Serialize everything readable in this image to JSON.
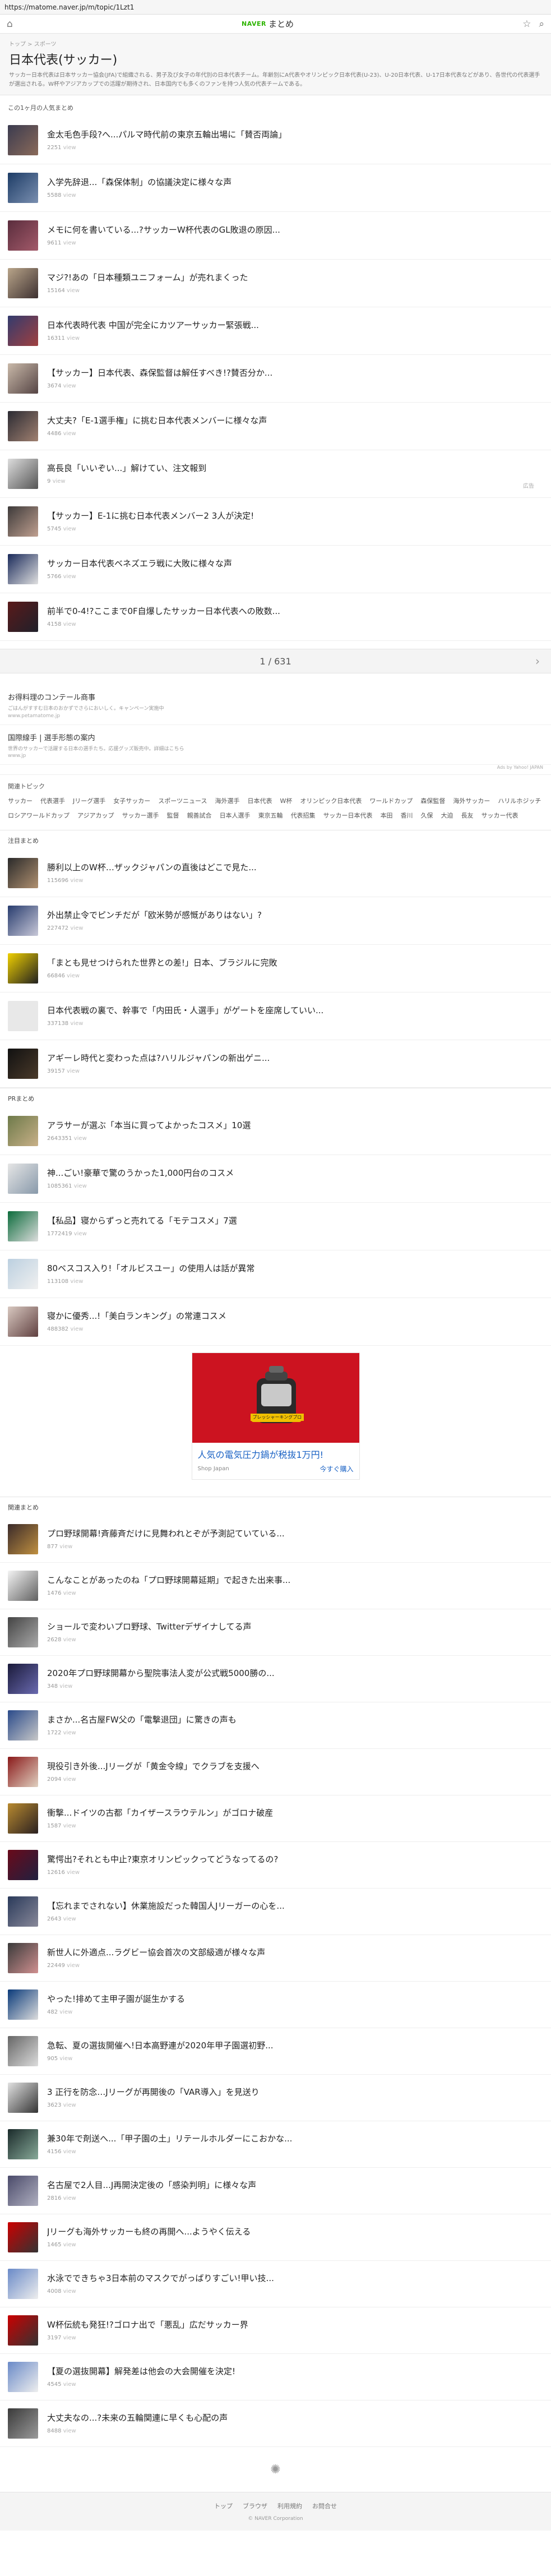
{
  "browser": {
    "url": "https://matome.naver.jp/m/topic/1Lzt1"
  },
  "header": {
    "brand": "NAVER",
    "product": "まとめ"
  },
  "topic": {
    "breadcrumb": "トップ > スポーツ",
    "title": "日本代表(サッカー)",
    "description": "サッカー日本代表は日本サッカー協会(JFA)で組織される、男子及び女子の年代別の日本代表チーム。年齢別にA代表やオリンピック日本代表(U-23)、U-20日本代表、U-17日本代表などがあり、各世代の代表選手が選出される。W杯やアジアカップでの活躍が期待され、日本国内でも多くのファンを持つ人気の代表チームである。"
  },
  "section_popular": "この1ヶ月の人気まとめ",
  "topic_items": [
    {
      "title": "金太毛色手段?へ...パルマ時代前の東京五輪出場に「賛否両論」",
      "views": "2251",
      "unit": "view"
    },
    {
      "title": "入学先辞退...「森保体制」の協議決定に様々な声",
      "views": "5588",
      "unit": "view"
    },
    {
      "title": "メモに何を書いている...?サッカーW杯代表のGL敗退の原因...",
      "views": "9611",
      "unit": "view"
    },
    {
      "title": "マジ?!あの「日本種類ユニフォーム」が売れまくった",
      "views": "15164",
      "unit": "view"
    },
    {
      "title": "日本代表時代表 中国が完全にカツアーサッカー緊張戦...",
      "views": "16311",
      "unit": "view"
    },
    {
      "title": "【サッカー】日本代表、森保監督は解任すべき!?賛否分か...",
      "views": "3674",
      "unit": "view"
    },
    {
      "title": "大丈夫?「E-1選手権」に挑む日本代表メンバーに様々な声",
      "views": "4486",
      "unit": "view"
    },
    {
      "title": "高長良「いいぞい...」解けてい、注文報到",
      "views": "9",
      "unit": "view",
      "note": "広告"
    },
    {
      "title": "【サッカー】E-1に挑む日本代表メンバー2 3人が決定!",
      "views": "5745",
      "unit": "view"
    },
    {
      "title": "サッカー日本代表ベネズエラ戦に大敗に様々な声",
      "views": "5766",
      "unit": "view"
    },
    {
      "title": "前半で0-4!?ここまで0F自爆したサッカー日本代表への敗数...",
      "views": "4158",
      "unit": "view"
    }
  ],
  "pager": {
    "label": "1 / 631"
  },
  "text_ads": [
    {
      "title": "お得料理のコンテール商事",
      "desc": "ごはんがすすむ日本のおかずでさらにおいしく。キャンペーン実施中",
      "url": "www.petamatome.jp"
    },
    {
      "title": "国際線手 | 選手形態の案内",
      "desc": "世界のサッカーで活躍する日本の選手たち。応援グッズ販売中。詳細はこちら",
      "url": "www.jp"
    }
  ],
  "ad_attribution": "Ads by Yahoo! JAPAN",
  "keywords": {
    "title": "関連トピック",
    "items": [
      "サッカー",
      "代表選手",
      "Jリーグ選手",
      "女子サッカー",
      "スポーツニュース",
      "海外選手",
      "日本代表",
      "W杯",
      "オリンピック日本代表",
      "ワールドカップ",
      "森保監督",
      "海外サッカー",
      "ハリルホジッチ",
      "ロシアワールドカップ",
      "アジアカップ",
      "サッカー選手",
      "監督",
      "親善試合",
      "日本人選手",
      "東京五輪",
      "代表招集",
      "サッカー日本代表",
      "本田",
      "香川",
      "久保",
      "大迫",
      "長友",
      "サッカー代表"
    ]
  },
  "section_special": "注目まとめ",
  "special_items": [
    {
      "title": "勝利以上のW杯…ザックジャパンの直後はどこで見た...",
      "views": "115696",
      "unit": "view"
    },
    {
      "title": "外出禁止令でピンチだが「欧米勢が感慨がありはない」?",
      "views": "227472",
      "unit": "view"
    },
    {
      "title": "「まとも見せつけられた世界との差!」日本、ブラジルに完敗",
      "views": "66846",
      "unit": "view"
    },
    {
      "title": "日本代表戦の裏で、幹事で「内田氏・人選手」がゲートを座席していい...",
      "views": "337138",
      "unit": "view"
    },
    {
      "title": "アギーレ時代と変わった点は?ハリルジャパンの新出ゲニ...",
      "views": "39157",
      "unit": "view"
    }
  ],
  "section_pr": "PRまとめ",
  "pr_items": [
    {
      "title": "アラサーが選ぶ「本当に買ってよかったコスメ」10選",
      "views": "2643351",
      "unit": "view"
    },
    {
      "title": "神...ごい!豪華で驚のうかった1,000円台のコスメ",
      "views": "1085361",
      "unit": "view"
    },
    {
      "title": "【私品】寝からずっと売れてる「モテコスメ」7選",
      "views": "1772419",
      "unit": "view"
    },
    {
      "title": "80ベスコス入り!「オルビスユー」の使用人は話が異常",
      "views": "113108",
      "unit": "view"
    },
    {
      "title": "寝かに優秀...!「美白ランキング」の常連コスメ",
      "views": "488382",
      "unit": "view"
    }
  ],
  "banner_ad": {
    "badge": "プレッシャーキングプロ",
    "headline": "人気の電気圧力鍋が税抜1万円!",
    "shop": "Shop Japan",
    "cta": "今すぐ購入"
  },
  "section_related": "関連まとめ",
  "related_items": [
    {
      "title": "プロ野球開幕!斉藤斉だけに見舞われとぞが予測記ていている...",
      "views": "877",
      "unit": "view"
    },
    {
      "title": "こんなことがあったのね「プロ野球開幕延期」で起きた出来事...",
      "views": "1476",
      "unit": "view"
    },
    {
      "title": "ショールで変わいプロ野球、Twitterデザイナしてる声",
      "views": "2628",
      "unit": "view"
    },
    {
      "title": "2020年プロ野球開幕から聖院事法人変が公式戦5000勝の...",
      "views": "348",
      "unit": "view"
    },
    {
      "title": "まさか...名古屋FW父の「電撃退団」に驚きの声も",
      "views": "1722",
      "unit": "view"
    },
    {
      "title": "現役引き外後...Jリーグが「黄金令線」でクラブを支援へ",
      "views": "2094",
      "unit": "view"
    },
    {
      "title": "衝撃...ドイツの古都「カイザースラウテルン」がゴロナ破産",
      "views": "1587",
      "unit": "view"
    },
    {
      "title": "驚愕出?それとも中止?東京オリンピックってどうなってるの?",
      "views": "12616",
      "unit": "view"
    },
    {
      "title": "【忘れまでされない】休業施設だった韓国人Jリーガーの心を...",
      "views": "2643",
      "unit": "view"
    },
    {
      "title": "新世人に外適点...ラグビー協会首次の文部級適が様々な声",
      "views": "22449",
      "unit": "view"
    },
    {
      "title": "やった!排めて主甲子園が誕生かする",
      "views": "482",
      "unit": "view"
    },
    {
      "title": "急転、夏の選抜開催へ!日本高野連が2020年甲子園選初野...",
      "views": "905",
      "unit": "view"
    },
    {
      "title": "3 正行を防念…Jリーグが再開後の「VAR導入」を見送り",
      "views": "3623",
      "unit": "view"
    },
    {
      "title": "兼30年で剤送へ...「甲子園の土」リテールホルダーにこおかな...",
      "views": "4156",
      "unit": "view"
    },
    {
      "title": "名古屋で2人目...J再開決定後の「感染判明」に様々な声",
      "views": "2816",
      "unit": "view"
    },
    {
      "title": "Jリーグも海外サッカーも終の再開へ...ようやく伝える",
      "views": "1465",
      "unit": "view"
    },
    {
      "title": "水泳でできちゃ3日本前のマスクでがっばりすごい!甲い技...",
      "views": "4008",
      "unit": "view"
    },
    {
      "title": "W杯伝統も発狂!?ゴロナ出で「悪乱」広だサッカー界",
      "views": "3197",
      "unit": "view"
    },
    {
      "title": "【夏の選抜開幕】解発差は他会の大会開催を決定!",
      "views": "4545",
      "unit": "view"
    },
    {
      "title": "大丈夫なの...?未来の五輪関連に早くも心配の声",
      "views": "8488",
      "unit": "view"
    }
  ],
  "footer": {
    "links": [
      "トップ",
      "ブラウザ",
      "利用規約",
      "お問合せ"
    ],
    "copyright": "© NAVER Corporation"
  }
}
